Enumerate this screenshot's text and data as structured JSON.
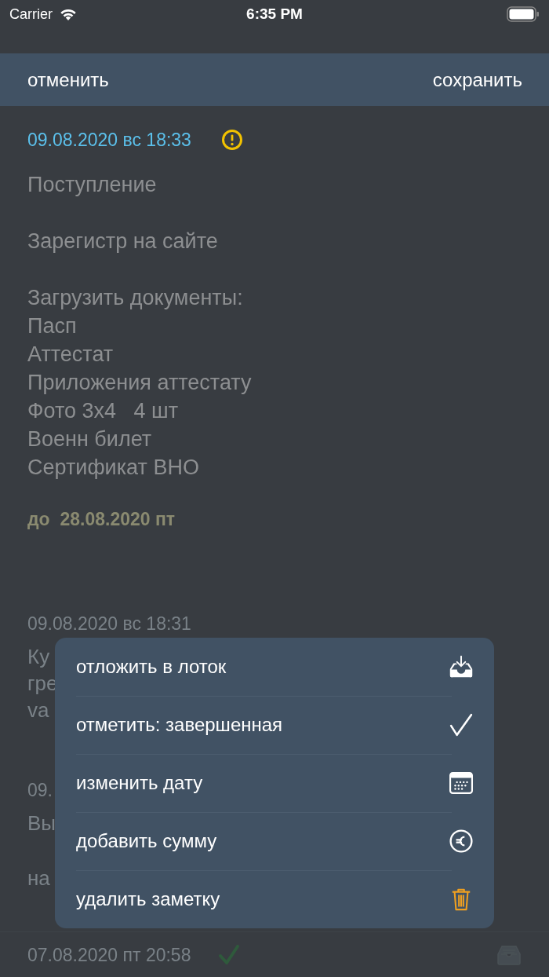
{
  "status_bar": {
    "carrier": "Carrier",
    "time": "6:35 PM"
  },
  "nav": {
    "cancel": "отменить",
    "save": "сохранить"
  },
  "note": {
    "date": "09.08.2020 вс 18:33",
    "warning": true,
    "paragraphs": [
      [
        "Поступление"
      ],
      [
        "Зарегистр на сайте"
      ],
      [
        "Загрузить документы:",
        "Пасп",
        "Аттестат",
        "Приложения аттестату",
        "Фото 3x4   4 шт",
        "Военн билет",
        "Сертификат ВНО"
      ]
    ],
    "due": "до  28.08.2020 пт"
  },
  "background_notes": [
    {
      "date": "09.08.2020 вс 18:31",
      "paragraphs": [
        [
          "Ку",
          "гре",
          "va"
        ]
      ]
    },
    {
      "date": "09.",
      "paragraphs": [
        [
          "Вы"
        ],
        [
          "на"
        ]
      ]
    }
  ],
  "footer_note": {
    "date": "07.08.2020 пт 20:58",
    "completed": true
  },
  "menu": [
    {
      "label": "отложить в лоток",
      "kind": "tray"
    },
    {
      "label": "отметить: завершенная",
      "kind": "check"
    },
    {
      "label": "изменить дату",
      "kind": "calendar"
    },
    {
      "label": "добавить сумму",
      "kind": "euro"
    },
    {
      "label": "удалить заметку",
      "kind": "trash"
    }
  ]
}
